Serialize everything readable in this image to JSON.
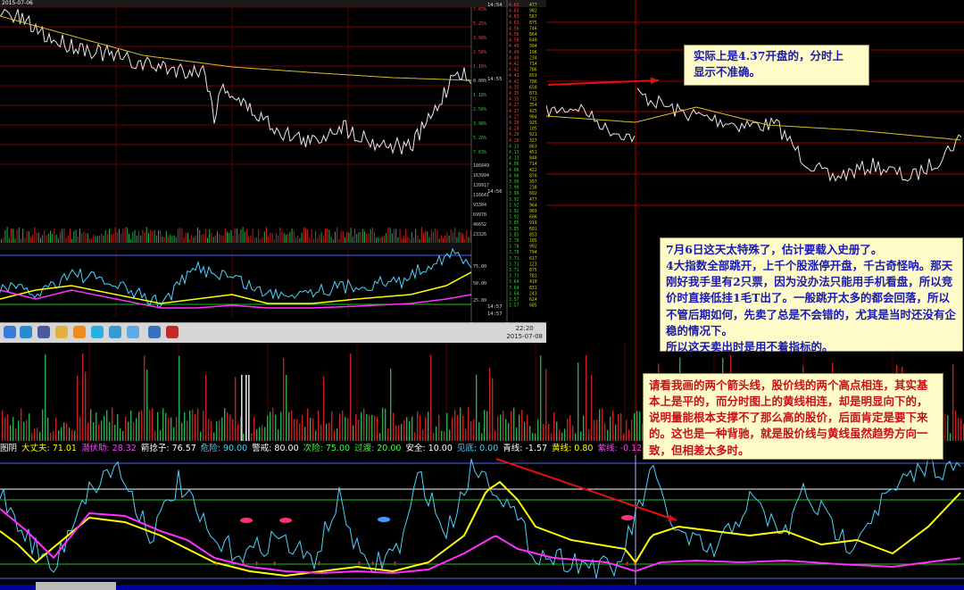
{
  "screenshot": {
    "title": "2015-07-06",
    "times": [
      "14:54",
      "14:55",
      "14:56",
      "14:57",
      "14:57"
    ],
    "price_levels": [
      "4.63",
      "4.56",
      "4.49",
      "4.42",
      "4.35",
      "4.27",
      "4.20",
      "4.13",
      "4.06",
      "3.99",
      "3.92",
      "3.85",
      "3.78",
      "3.71",
      "3.64",
      "3.57"
    ],
    "percent_levels": [
      "7.03%",
      "5.25%",
      "3.98%",
      "2.56%",
      "1.18%",
      "0.00%",
      "1.18%",
      "2.56%",
      "3.98%",
      "5.26%",
      "7.03%"
    ],
    "volume_levels": [
      "186849",
      "163994",
      "139917",
      "116641",
      "93304",
      "69978",
      "46652",
      "23326"
    ],
    "indicator_levels": [
      "75.00",
      "50.00",
      "25.00"
    ],
    "clock_time": "22:20",
    "clock_date": "2015-07-08"
  },
  "notes": {
    "note1": "实际上是4.37开盘的，分时上\n显示不准确。",
    "note2": "  7月6日这天太特殊了，估计要载入史册了。\n  4大指数全部跳开，上千个股涨停开盘，千古奇怪呐。那天刚好我手里有2只票，因为没办法只能用手机看盘，所以竞价时直接低挂1毛T出了。一般跳开太多的都会回落，所以不管后期如何，先卖了总是不会错的，尤其是当时还没有企稳的情况下。\n  所以这天卖出时是用不着指标的。",
    "note3": "  请看我画的两个箭头线，股价线的两个高点相连，其实基本上是平的，而分时图上的黄线相连，却是明显向下的，说明量能根本支撑不了那么高的股价，后面肯定是要下来的。这也是一种背驰，就是股价线与黄线虽然趋势方向一致，但相差太多时。"
  },
  "indicator_bar": {
    "items": [
      {
        "label": "图阴",
        "color": "#ffffff"
      },
      {
        "label": "大丈夫: 71.01",
        "color": "#ffff00"
      },
      {
        "label": "潜伏助: 28.32",
        "color": "#ff40ff"
      },
      {
        "label": "箭捻子: 76.57",
        "color": "#ffffff"
      },
      {
        "label": "危险: 90.00",
        "color": "#4ad4ff"
      },
      {
        "label": "警戒: 80.00",
        "color": "#ffffff"
      },
      {
        "label": "次险: 75.00",
        "color": "#3cff3c"
      },
      {
        "label": "过渡: 20.00",
        "color": "#3cff3c"
      },
      {
        "label": "安全: 10.00",
        "color": "#ffffff"
      },
      {
        "label": "见底: 0.00",
        "color": "#4ad4ff"
      },
      {
        "label": "青线: -1.57",
        "color": "#ffffff"
      },
      {
        "label": "黄线: 0.80",
        "color": "#ffff00"
      },
      {
        "label": "紫线: -0.12",
        "color": "#ff40ff"
      }
    ]
  },
  "colors": {
    "price_line": "#e8e8e8",
    "avg_line": "#d8c020",
    "cyan_line": "#4ad4ff",
    "yellow_line": "#ffff00",
    "magenta_line": "#ff30ff",
    "grid_red": "#a00000",
    "arrow": "#e01010"
  }
}
